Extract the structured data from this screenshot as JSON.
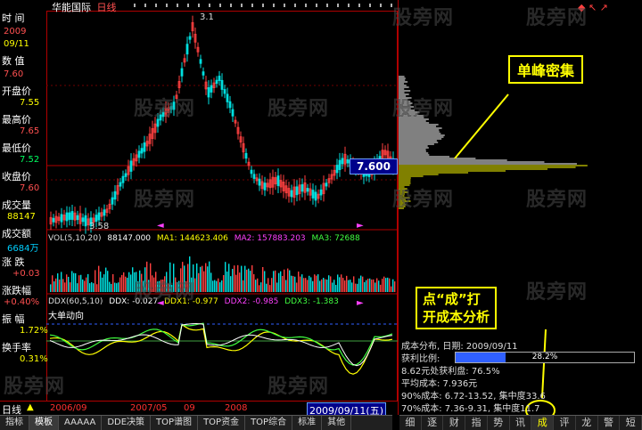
{
  "header": {
    "stock_name": "华能国际",
    "period": "日线"
  },
  "left_panel": {
    "labels": {
      "time": "时  间",
      "value": "数  值",
      "open": "开盘价",
      "high": "最高价",
      "low": "最低价",
      "close": "收盘价",
      "volume": "成交量",
      "amount": "成交额",
      "change": "涨  跌",
      "change_pct": "涨跌幅",
      "amplitude": "振  幅",
      "turnover": "换手率"
    },
    "values": {
      "year": "2009",
      "date": "09/11",
      "value": "7.60",
      "open": "7.55",
      "high": "7.65",
      "low": "7.52",
      "close": "7.60",
      "volume": "88147",
      "amount": "6684万",
      "change": "+0.03",
      "change_pct": "+0.40%",
      "amplitude": "1.72%",
      "turnover": "0.31%"
    },
    "colors": {
      "label": "#ffffff",
      "value_red": "#ff5050",
      "value_yellow": "#ffff00",
      "value_cyan": "#00d0ff"
    }
  },
  "main_chart": {
    "price_tag": "7.600",
    "low_label": "3.58",
    "high_label": "3.1",
    "vol_row": {
      "name": "VOL(5,10,20)",
      "v": "88147.000",
      "ma1": "MA1: 144623.406",
      "ma2": "MA2: 157883.203",
      "ma3": "MA3: 72688"
    },
    "ddx_row": {
      "name": "DDX(60,5,10)",
      "ddx": "DDX: -0.027",
      "ddx1": "DDX1: -0.977",
      "ddx2": "DDX2: -0.985",
      "ddx3": "DDX3: -1.383"
    },
    "ddx_title": "大单动向"
  },
  "bottom_bar": {
    "period": "日线",
    "dates": [
      "2006/09",
      "2007/05",
      "09",
      "2008"
    ],
    "current_date": "2009/09/11(五)",
    "tabs": [
      "指标",
      "模板",
      "AAAAA",
      "DDE决策",
      "TOP谱图",
      "TOP资金",
      "TOP综合",
      "标准",
      "其他"
    ]
  },
  "right_panel": {
    "callouts": {
      "peak": "单峰密集",
      "click_hint_line1": "点“成”打",
      "click_hint_line2": "开成本分析"
    },
    "cost": {
      "title": "成本分布, 日期: 2009/09/11",
      "profit_label": "获利比例:",
      "profit_pct": "28.2%",
      "profit_fraction": 0.282,
      "line3": "8.62元处获利盘: 76.5%",
      "line4": "平均成本: 7.936元",
      "line5": "90%成本: 6.72-13.52, 集中度33.6",
      "line6": "70%成本: 7.36-9.31, 集中度11.7"
    },
    "tabs": [
      "细",
      "逐",
      "财",
      "指",
      "势",
      "讯",
      "成",
      "评",
      "龙",
      "警",
      "短"
    ],
    "active_tab": "成"
  },
  "watermark": "股旁网"
}
